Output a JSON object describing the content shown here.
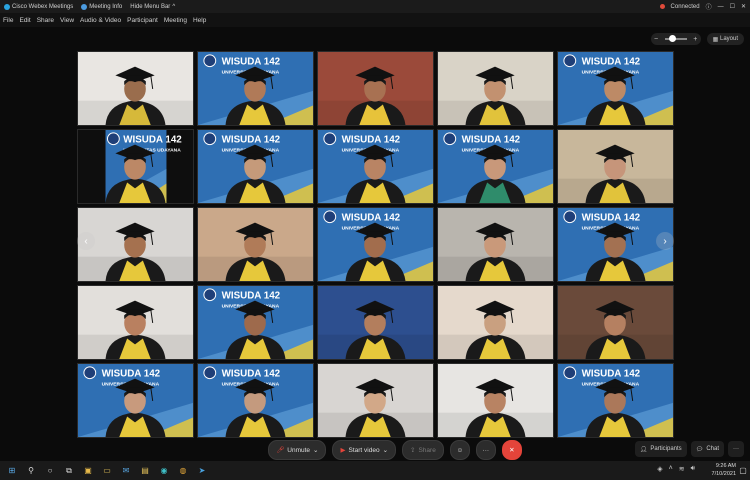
{
  "window": {
    "app_tab": "Cisco Webex Meetings",
    "info_tab": "Meeting Info",
    "hide_menu": "Hide Menu Bar",
    "status": "Connected"
  },
  "menu": [
    "File",
    "Edit",
    "Share",
    "View",
    "Audio & Video",
    "Participant",
    "Meeting",
    "Help"
  ],
  "toolbar": {
    "layout_label": "Layout"
  },
  "banner": {
    "title": "WISUDA 142",
    "subtitle": "UNIVERSITAS UDAYANA"
  },
  "tiles": [
    {
      "type": "person",
      "bg": "#e9e6e2",
      "gown": "#d6b93a",
      "skin": "#9a6d4d",
      "banner": false
    },
    {
      "type": "banner",
      "skin": "#b07a58",
      "gown": "#e6c83b"
    },
    {
      "type": "person",
      "bg": "#9b4a3a",
      "gown": "#e7c33a",
      "skin": "#a87152",
      "banner": false
    },
    {
      "type": "person",
      "bg": "#d9d3c7",
      "gown": "#e1c33b",
      "skin": "#c29170",
      "banner": false
    },
    {
      "type": "banner-side",
      "skin": "#bd8a66",
      "gown": "#e6c83b"
    },
    {
      "type": "banner-dark",
      "skin": "#bc8866",
      "gown": "#e6c83b"
    },
    {
      "type": "banner",
      "skin": "#c59a7a",
      "gown": "#e6c83b"
    },
    {
      "type": "banner",
      "skin": "#b98464",
      "gown": "#e6c83b"
    },
    {
      "type": "banner",
      "skin": "#c8987a",
      "gown": "#2f8c6b"
    },
    {
      "type": "person",
      "bg": "#c8b79b",
      "gown": "#e1c33b",
      "skin": "#c6957a",
      "banner": false
    },
    {
      "type": "person",
      "bg": "#d8d6d3",
      "gown": "#e6c83b",
      "skin": "#a5714f",
      "banner": false
    },
    {
      "type": "person",
      "bg": "#caa88a",
      "gown": "#e6c83b",
      "skin": "#b07b58",
      "banner": false
    },
    {
      "type": "banner",
      "skin": "#a26d4d",
      "gown": "#e6c83b"
    },
    {
      "type": "person",
      "bg": "#b9b5ae",
      "gown": "#e6c83b",
      "skin": "#c9997a",
      "banner": false
    },
    {
      "type": "banner",
      "skin": "#a37152",
      "gown": "#e6c83b"
    },
    {
      "type": "person",
      "bg": "#e2dfdb",
      "gown": "#e6c83b",
      "skin": "#b98060",
      "banner": false
    },
    {
      "type": "banner",
      "skin": "#9e6a4c",
      "gown": "#e6c83b"
    },
    {
      "type": "person",
      "bg": "#2d4f8f",
      "gown": "#e6c83b",
      "skin": "#b37e5d",
      "banner": false
    },
    {
      "type": "person",
      "bg": "#e5d9cc",
      "gown": "#e6c83b",
      "skin": "#c9a080",
      "banner": false
    },
    {
      "type": "person",
      "bg": "#6a4a3a",
      "gown": "#e6c83b",
      "skin": "#b58061",
      "banner": false
    },
    {
      "type": "banner",
      "skin": "#c89a7d",
      "gown": "#e6c83b"
    },
    {
      "type": "banner",
      "skin": "#c49a7e",
      "gown": "#e6c83b"
    },
    {
      "type": "person",
      "bg": "#d8d5d2",
      "gown": "#e6c83b",
      "skin": "#d2a888",
      "banner": false
    },
    {
      "type": "person",
      "bg": "#e7e5e2",
      "gown": "#e6c83b",
      "skin": "#b88363",
      "banner": false
    },
    {
      "type": "banner",
      "skin": "#ab785a",
      "gown": "#e6c83b"
    }
  ],
  "controls": {
    "unmute": "Unmute",
    "start_video": "Start video",
    "share": "Share"
  },
  "panels": {
    "participants": "Participants",
    "chat": "Chat"
  },
  "clock": {
    "time": "9:26 AM",
    "date": "7/10/2021"
  }
}
